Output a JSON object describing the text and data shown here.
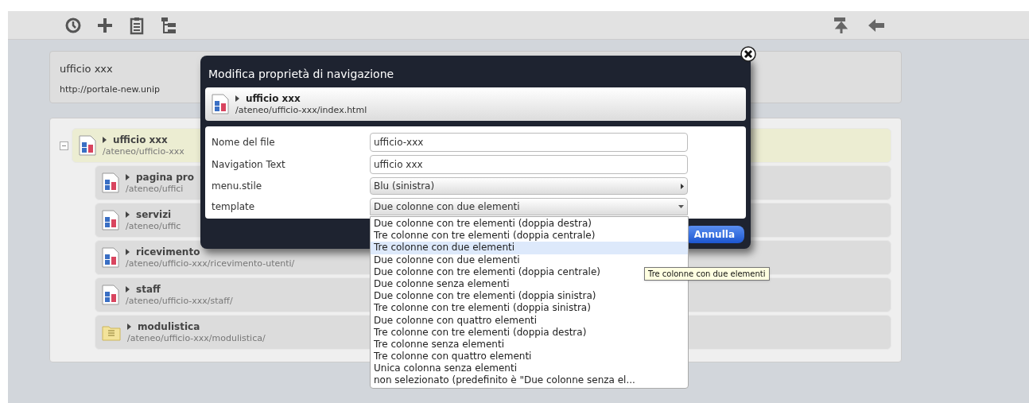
{
  "info_card": {
    "title": "ufficio xxx",
    "url": "http://portale-new.unip"
  },
  "tree": {
    "title": "ufficio xxx",
    "path": "/ateneo/ufficio-xxx",
    "selected": true,
    "expanded": true,
    "kind": "page",
    "children": [
      {
        "title": "pagina pro",
        "path": "/ateneo/uffici",
        "kind": "page",
        "selected": false
      },
      {
        "title": "servizi",
        "path": "/ateneo/uffic",
        "kind": "page",
        "selected": false
      },
      {
        "title": "ricevimento",
        "path": "/ateneo/ufficio-xxx/ricevimento-utenti/",
        "kind": "page",
        "selected": false
      },
      {
        "title": "staff",
        "path": "/ateneo/ufficio-xxx/staff/",
        "kind": "page",
        "selected": false
      },
      {
        "title": "modulistica",
        "path": "/ateneo/ufficio-xxx/modulistica/",
        "kind": "folder",
        "selected": false
      }
    ]
  },
  "dialog": {
    "title": "Modifica proprietà di navigazione",
    "item_title": "ufficio xxx",
    "item_path": "/ateneo/ufficio-xxx/index.html",
    "fields": [
      {
        "label": "Nome del file",
        "kind": "text",
        "value": "ufficio-xxx"
      },
      {
        "label": "Navigation Text",
        "kind": "text",
        "value": "ufficio xxx"
      },
      {
        "label": "menu.stile",
        "kind": "menu",
        "value": "Blu (sinistra)"
      },
      {
        "label": "template",
        "kind": "select",
        "value": "Due colonne con due elementi",
        "expanded": true
      }
    ],
    "button": "Annulla"
  },
  "dropdown": {
    "options": [
      {
        "label": "Due colonne con tre elementi (doppia destra)",
        "selected": false
      },
      {
        "label": "Tre colonne con tre elementi (doppia centrale)",
        "selected": false
      },
      {
        "label": "Tre colonne con due elementi",
        "selected": true
      },
      {
        "label": "Due colonne con due elementi",
        "selected": false
      },
      {
        "label": "Due colonne con tre elementi (doppia centrale)",
        "selected": false
      },
      {
        "label": "Due colonne senza elementi",
        "selected": false
      },
      {
        "label": "Due colonne con tre elementi (doppia sinistra)",
        "selected": false
      },
      {
        "label": "Tre colonne con tre elementi (doppia sinistra)",
        "selected": false
      },
      {
        "label": "Due colonne con quattro elementi",
        "selected": false
      },
      {
        "label": "Tre colonne con tre elementi (doppia destra)",
        "selected": false
      },
      {
        "label": "Tre colonne senza elementi",
        "selected": false
      },
      {
        "label": "Tre colonne con quattro elementi",
        "selected": false
      },
      {
        "label": "Unica colonna senza elementi",
        "selected": false
      },
      {
        "label": "non selezionato (predefinito è \"Due colonne senza el...",
        "selected": false
      }
    ]
  },
  "tooltip": "Tre colonne con due elementi"
}
